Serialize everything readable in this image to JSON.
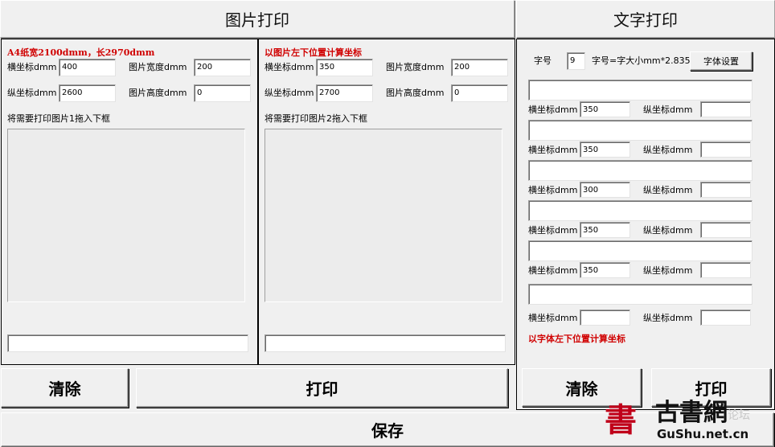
{
  "image_panel": {
    "header_title": "图片打印",
    "left": {
      "note": "A4纸宽2100dmm，长2970dmm",
      "x_label": "横坐标dmm",
      "x_value": "400",
      "width_label": "图片宽度dmm",
      "width_value": "200",
      "y_label": "纵坐标dmm",
      "y_value": "2600",
      "height_label": "图片高度dmm",
      "height_value": "0",
      "drop_hint": "将需要打印图片1拖入下框",
      "path_value": ""
    },
    "right": {
      "note": "以图片左下位置计算坐标",
      "x_label": "横坐标dmm",
      "x_value": "350",
      "width_label": "图片宽度dmm",
      "width_value": "200",
      "y_label": "纵坐标dmm",
      "y_value": "2700",
      "height_label": "图片高度dmm",
      "height_value": "0",
      "drop_hint": "将需要打印图片2拖入下框",
      "path_value": ""
    },
    "clear_label": "清除",
    "print_label": "打印"
  },
  "save_label": "保存",
  "text_panel": {
    "header_title": "文字打印",
    "font_size_label": "字号",
    "font_size_value": "9",
    "font_size_formula": "字号=字大小mm*2.835",
    "font_settings_label": "字体设置",
    "rows": [
      {
        "text": "",
        "x_label": "横坐标dmm",
        "x_value": "350",
        "y_label": "纵坐标dmm",
        "y_value": ""
      },
      {
        "text": "",
        "x_label": "横坐标dmm",
        "x_value": "350",
        "y_label": "纵坐标dmm",
        "y_value": ""
      },
      {
        "text": "",
        "x_label": "横坐标dmm",
        "x_value": "300",
        "y_label": "纵坐标dmm",
        "y_value": ""
      },
      {
        "text": "",
        "x_label": "横坐标dmm",
        "x_value": "350",
        "y_label": "纵坐标dmm",
        "y_value": ""
      },
      {
        "text": "",
        "x_label": "横坐标dmm",
        "x_value": "350",
        "y_label": "纵坐标dmm",
        "y_value": ""
      },
      {
        "text": "",
        "x_label": "横坐标dmm",
        "x_value": "",
        "y_label": "纵坐标dmm",
        "y_value": ""
      }
    ],
    "note": "以字体左下位置计算坐标",
    "clear_label": "清除",
    "print_label": "打印"
  },
  "watermark": {
    "logo_char": "書",
    "name": "古書網",
    "domain": "GuShu.net.cn",
    "faded_text": "论坛",
    "logo_color": "#c0001a"
  }
}
